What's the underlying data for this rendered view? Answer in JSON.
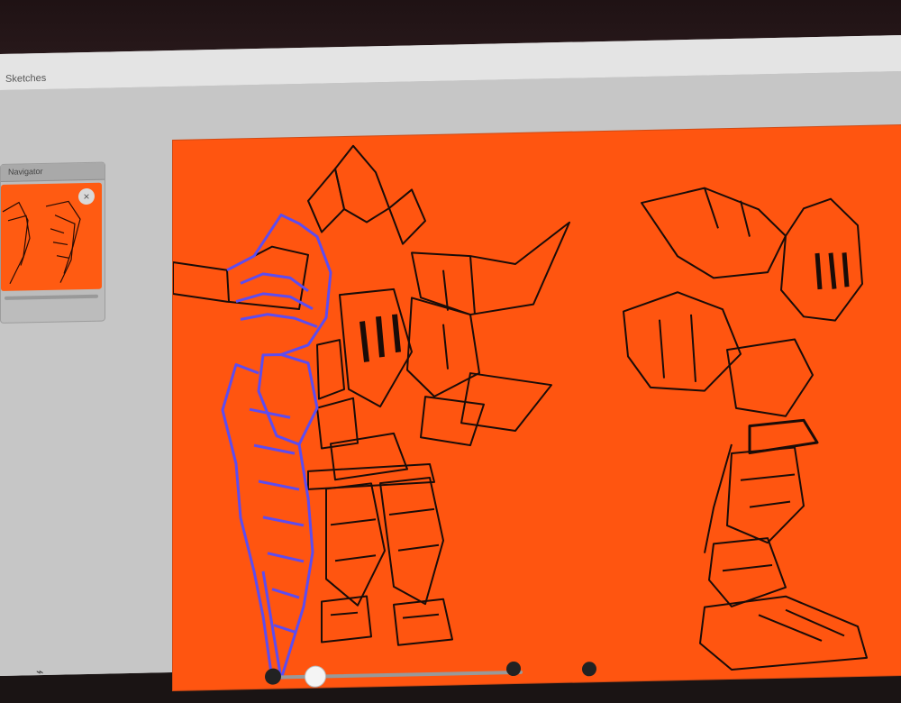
{
  "window": {
    "title": "Sketches"
  },
  "navigator": {
    "title": "Navigator",
    "close_icon": "close-icon"
  },
  "canvas": {
    "background": "#ff5510",
    "line_color": "#1a0c08",
    "highlight_color": "#5c4cf0",
    "subject": "armored-knight-with-sword"
  },
  "bottombar": {
    "zoom_label": "",
    "misc_label": ""
  },
  "icons": [
    "close-icon",
    "zoom-slider",
    "settings-icon"
  ]
}
